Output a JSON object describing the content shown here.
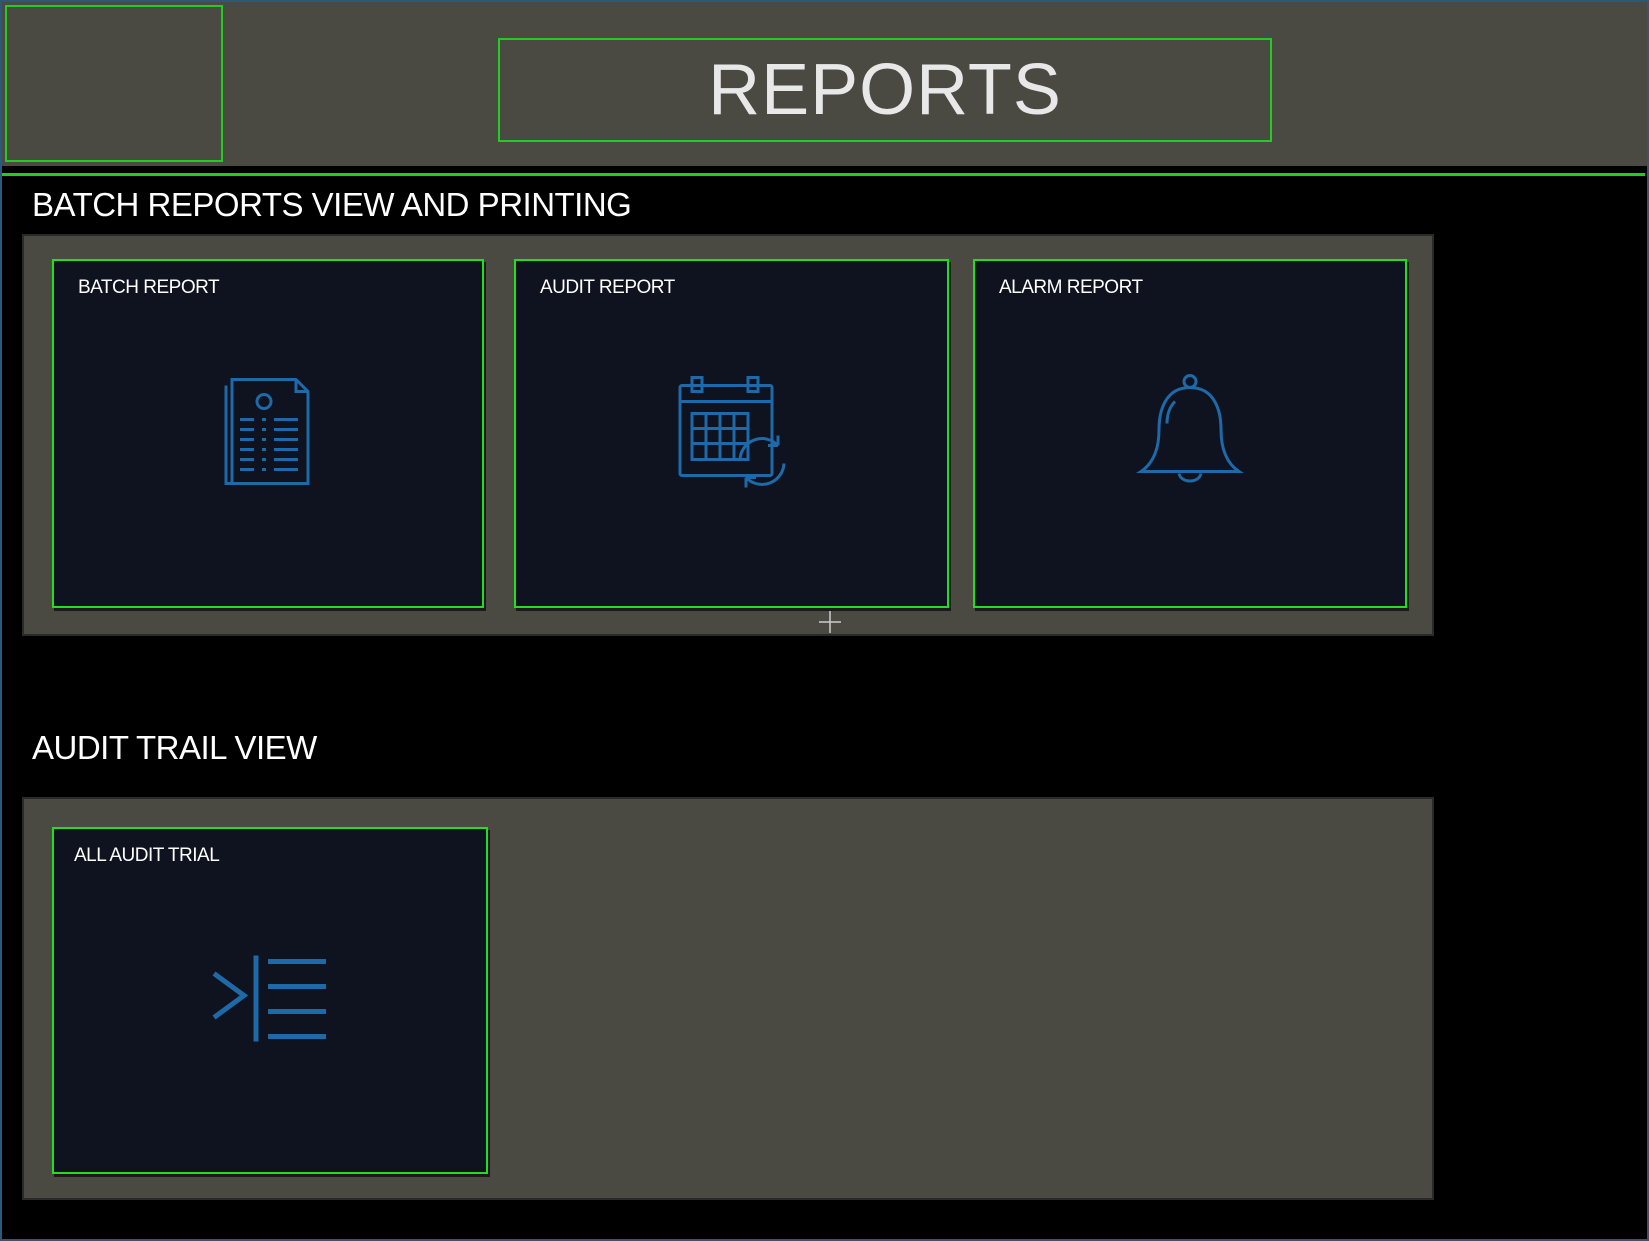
{
  "header": {
    "title": "REPORTS"
  },
  "sections": [
    {
      "title": "BATCH REPORTS VIEW AND PRINTING",
      "tiles": [
        {
          "label": "BATCH REPORT",
          "icon": "document-report-icon"
        },
        {
          "label": "AUDIT REPORT",
          "icon": "calendar-refresh-icon"
        },
        {
          "label": "ALARM REPORT",
          "icon": "bell-icon"
        }
      ]
    },
    {
      "title": "AUDIT TRAIL VIEW",
      "tiles": [
        {
          "label": "ALL AUDIT TRIAL",
          "icon": "indent-list-icon"
        }
      ]
    }
  ],
  "colors": {
    "background": "#000000",
    "panel": "#4a4a42",
    "tile": "#0f1320",
    "accent_border": "#22dd22",
    "icon": "#1e6aa8",
    "text": "#ffffff"
  }
}
